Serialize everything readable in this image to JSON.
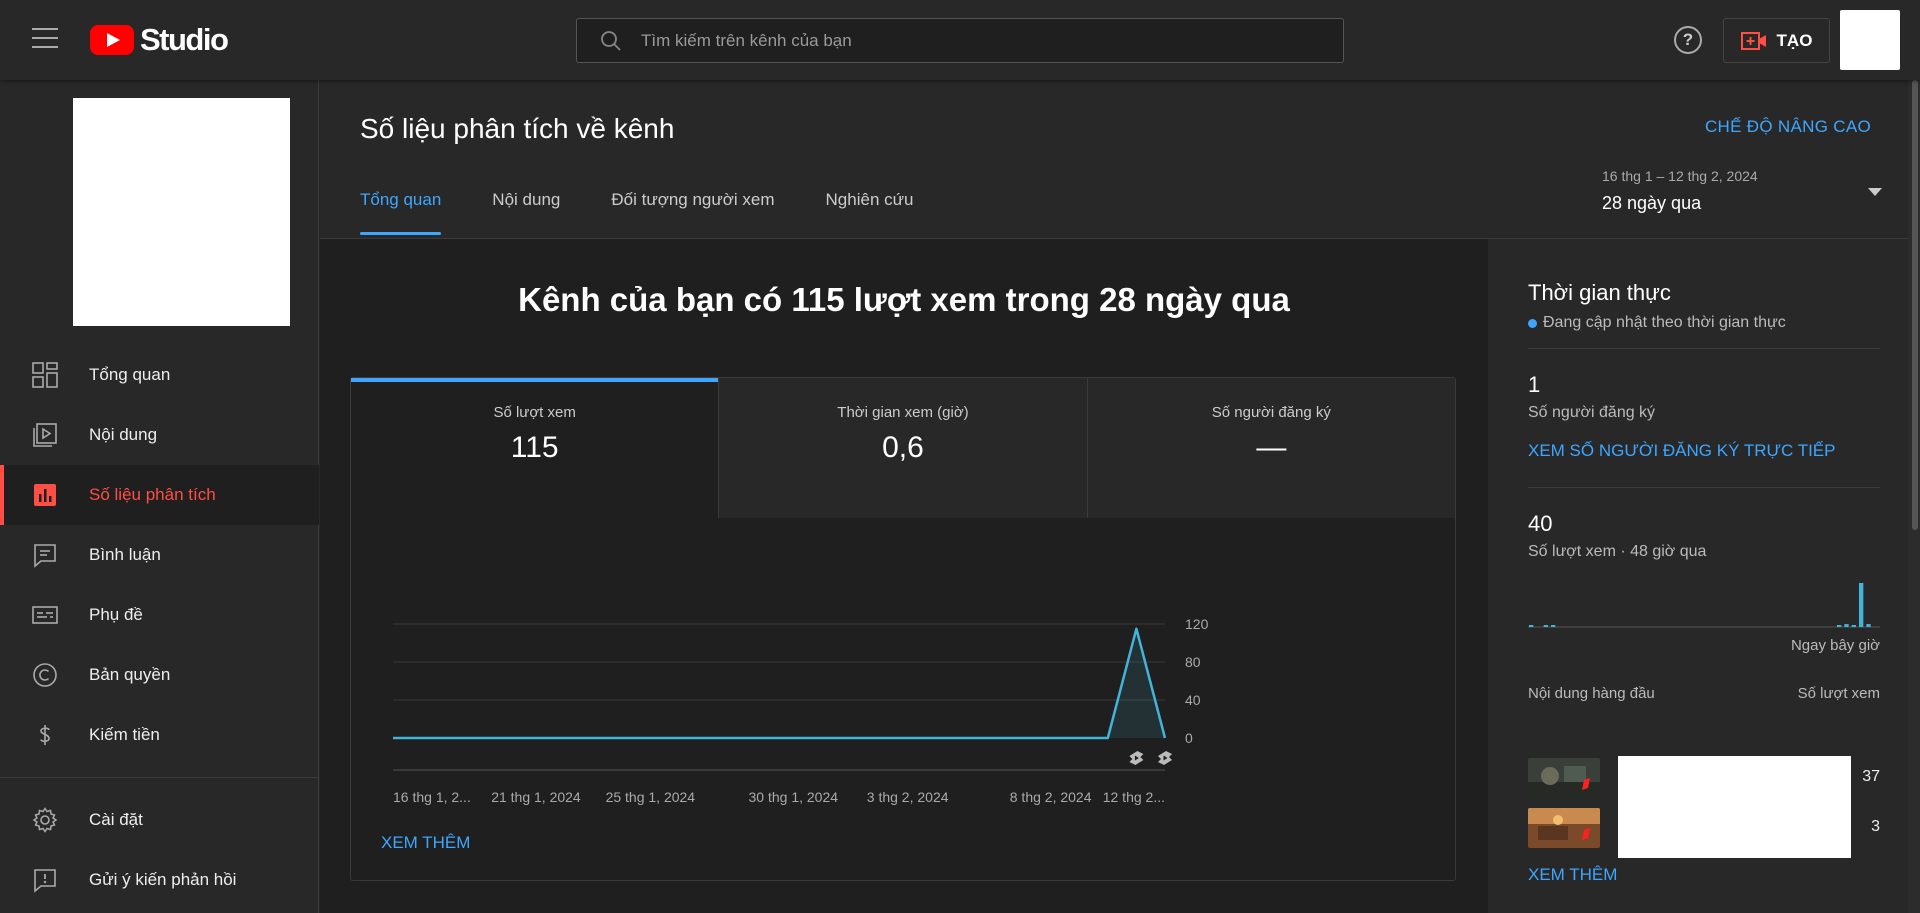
{
  "topbar": {
    "logo_text": "Studio",
    "search_placeholder": "Tìm kiếm trên kênh của bạn",
    "help_symbol": "?",
    "create_label": "TẠO"
  },
  "sidebar": {
    "items": [
      {
        "label": "Tổng quan",
        "icon": "dashboard-icon"
      },
      {
        "label": "Nội dung",
        "icon": "content-icon"
      },
      {
        "label": "Số liệu phân tích",
        "icon": "analytics-icon",
        "active": true
      },
      {
        "label": "Bình luận",
        "icon": "comments-icon"
      },
      {
        "label": "Phụ đề",
        "icon": "subtitles-icon"
      },
      {
        "label": "Bản quyền",
        "icon": "copyright-icon"
      },
      {
        "label": "Kiếm tiền",
        "icon": "dollar-icon"
      }
    ],
    "bottom_items": [
      {
        "label": "Cài đặt",
        "icon": "gear-icon"
      },
      {
        "label": "Gửi ý kiến phản hồi",
        "icon": "feedback-icon"
      }
    ]
  },
  "main": {
    "title": "Số liệu phân tích về kênh",
    "advanced_mode": "CHẾ ĐỘ NÂNG CAO",
    "tabs": [
      "Tổng quan",
      "Nội dung",
      "Đối tượng người xem",
      "Nghiên cứu"
    ],
    "date_range": {
      "range": "16 thg 1 – 12 thg 2, 2024",
      "label": "28 ngày qua"
    },
    "headline": "Kênh của bạn có 115 lượt xem trong 28 ngày qua",
    "metrics": [
      {
        "label": "Số lượt xem",
        "value": "115"
      },
      {
        "label": "Thời gian xem (giờ)",
        "value": "0,6"
      },
      {
        "label": "Số người đăng ký",
        "value": "—"
      }
    ],
    "see_more": "XEM THÊM"
  },
  "chart_data": {
    "type": "area",
    "x": [
      "16 thg 1",
      "17 thg 1",
      "18 thg 1",
      "19 thg 1",
      "20 thg 1",
      "21 thg 1",
      "22 thg 1",
      "23 thg 1",
      "24 thg 1",
      "25 thg 1",
      "26 thg 1",
      "27 thg 1",
      "28 thg 1",
      "29 thg 1",
      "30 thg 1",
      "31 thg 1",
      "1 thg 2",
      "2 thg 2",
      "3 thg 2",
      "4 thg 2",
      "5 thg 2",
      "6 thg 2",
      "7 thg 2",
      "8 thg 2",
      "9 thg 2",
      "10 thg 2",
      "11 thg 2",
      "12 thg 2"
    ],
    "values": [
      0,
      0,
      0,
      0,
      0,
      0,
      0,
      0,
      0,
      0,
      0,
      0,
      0,
      0,
      0,
      0,
      0,
      0,
      0,
      0,
      0,
      0,
      0,
      0,
      0,
      0,
      115,
      0
    ],
    "x_tick_labels": [
      "16 thg 1, 2...",
      "21 thg 1, 2024",
      "25 thg 1, 2024",
      "30 thg 1, 2024",
      "3 thg 2, 2024",
      "8 thg 2, 2024",
      "12 thg 2..."
    ],
    "x_tick_index": [
      0,
      5,
      9,
      14,
      18,
      23,
      27
    ],
    "y_ticks": [
      0,
      40,
      80,
      120
    ],
    "ylim": [
      0,
      120
    ],
    "grid": true,
    "y_axis_side": "right",
    "markers": [
      {
        "index": 26,
        "icon": "shorts-icon"
      },
      {
        "index": 27,
        "icon": "shorts-icon"
      }
    ],
    "line_color": "#41b4d8"
  },
  "realtime": {
    "title": "Thời gian thực",
    "subtitle": "Đang cập nhật theo thời gian thực",
    "subscribers_value": "1",
    "subscribers_label": "Số người đăng ký",
    "live_link": "XEM SỐ NGƯỜI ĐĂNG KÝ TRỰC TIẾP",
    "views_value": "40",
    "views_label": "Số lượt xem · 48 giờ qua",
    "now_label": "Ngay bây giờ",
    "bars": [
      1,
      0,
      1,
      1,
      0,
      0,
      0,
      0,
      0,
      0,
      0,
      0,
      0,
      0,
      0,
      0,
      0,
      0,
      0,
      0,
      0,
      0,
      0,
      0,
      0,
      0,
      0,
      0,
      0,
      0,
      0,
      0,
      0,
      0,
      0,
      0,
      0,
      0,
      0,
      0,
      0,
      0,
      1,
      2,
      1,
      30,
      2,
      0
    ],
    "top_content_header": "Nội dung hàng đầu",
    "top_views_header": "Số lượt xem",
    "top_items": [
      {
        "views": "37"
      },
      {
        "views": "3"
      }
    ],
    "see_more": "XEM THÊM"
  }
}
